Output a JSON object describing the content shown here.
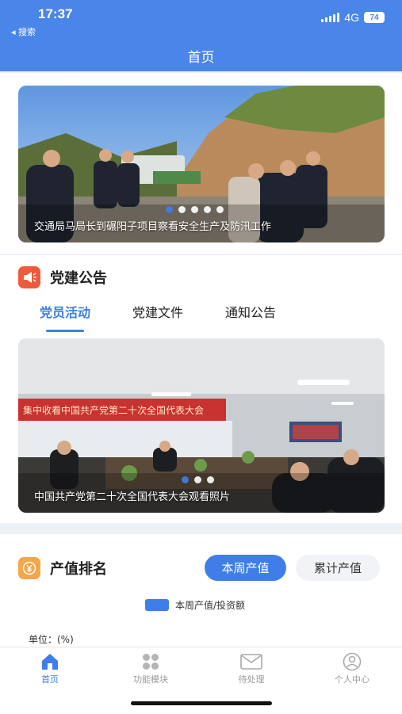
{
  "status": {
    "time": "17:37",
    "back_label": "◂ 搜索",
    "network": "4G",
    "battery": "74"
  },
  "header": {
    "title": "首页"
  },
  "banner1": {
    "caption": "交通局马局长到碾阳子项目察看安全生产及防汛工作",
    "dots": 5,
    "active_dot": 0
  },
  "party": {
    "title": "党建公告",
    "tabs": [
      {
        "label": "党员活动",
        "active": true
      },
      {
        "label": "党建文件",
        "active": false
      },
      {
        "label": "通知公告",
        "active": false
      }
    ],
    "banner": {
      "caption": "中国共产党第二十次全国代表大会观看照片",
      "sign_text": "集中收看中国共产党第二十次全国代表大会",
      "dots": 3,
      "active_dot": 0
    }
  },
  "ranking": {
    "title": "产值排名",
    "toggle": [
      {
        "label": "本周产值",
        "active": true
      },
      {
        "label": "累计产值",
        "active": false
      }
    ],
    "legend": "本周产值/投资额",
    "unit": "单位：(%)"
  },
  "tabbar": {
    "items": [
      {
        "label": "首页",
        "icon": "home-icon",
        "active": true
      },
      {
        "label": "功能模块",
        "icon": "grid-icon",
        "active": false
      },
      {
        "label": "待处理",
        "icon": "mail-icon",
        "active": false
      },
      {
        "label": "个人中心",
        "icon": "user-icon",
        "active": false
      }
    ]
  },
  "colors": {
    "primary": "#3f7ee8",
    "header": "#4a86ea",
    "party_icon": "#ef5a3c",
    "ranking_icon": "#f5a64a"
  }
}
